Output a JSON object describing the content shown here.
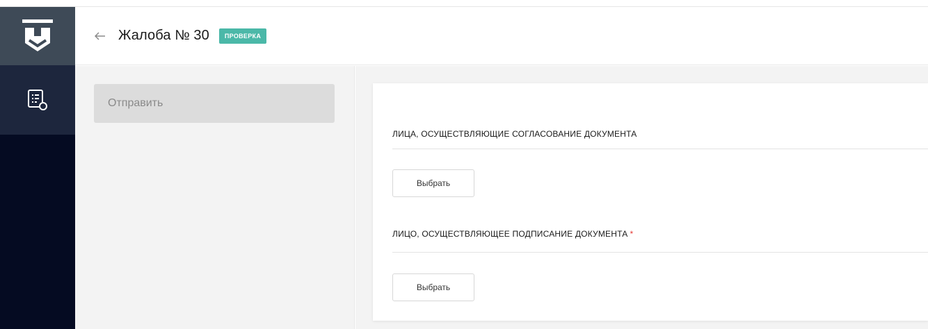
{
  "header": {
    "title": "Жалоба № 30",
    "status": "ПРОВЕРКА",
    "status_color": "#4bb8a8"
  },
  "sidebar": {
    "logo_icon": "shield-logo-icon",
    "items": [
      {
        "icon": "document-list-search-icon",
        "active": true
      }
    ]
  },
  "actions": {
    "send_label": "Отправить"
  },
  "form": {
    "approvers": {
      "title": "ЛИЦА, ОСУЩЕСТВЛЯЮЩИЕ СОГЛАСОВАНИЕ ДОКУМЕНТА",
      "button_label": "Выбрать"
    },
    "signer": {
      "title": "ЛИЦО, ОСУЩЕСТВЛЯЮЩЕЕ ПОДПИСАНИЕ ДОКУМЕНТА",
      "required_mark": "*",
      "button_label": "Выбрать"
    }
  },
  "colors": {
    "rail": "#050b22",
    "rail_logo": "#3e4a57",
    "rail_active": "#1d263d",
    "required": "#e53935"
  }
}
